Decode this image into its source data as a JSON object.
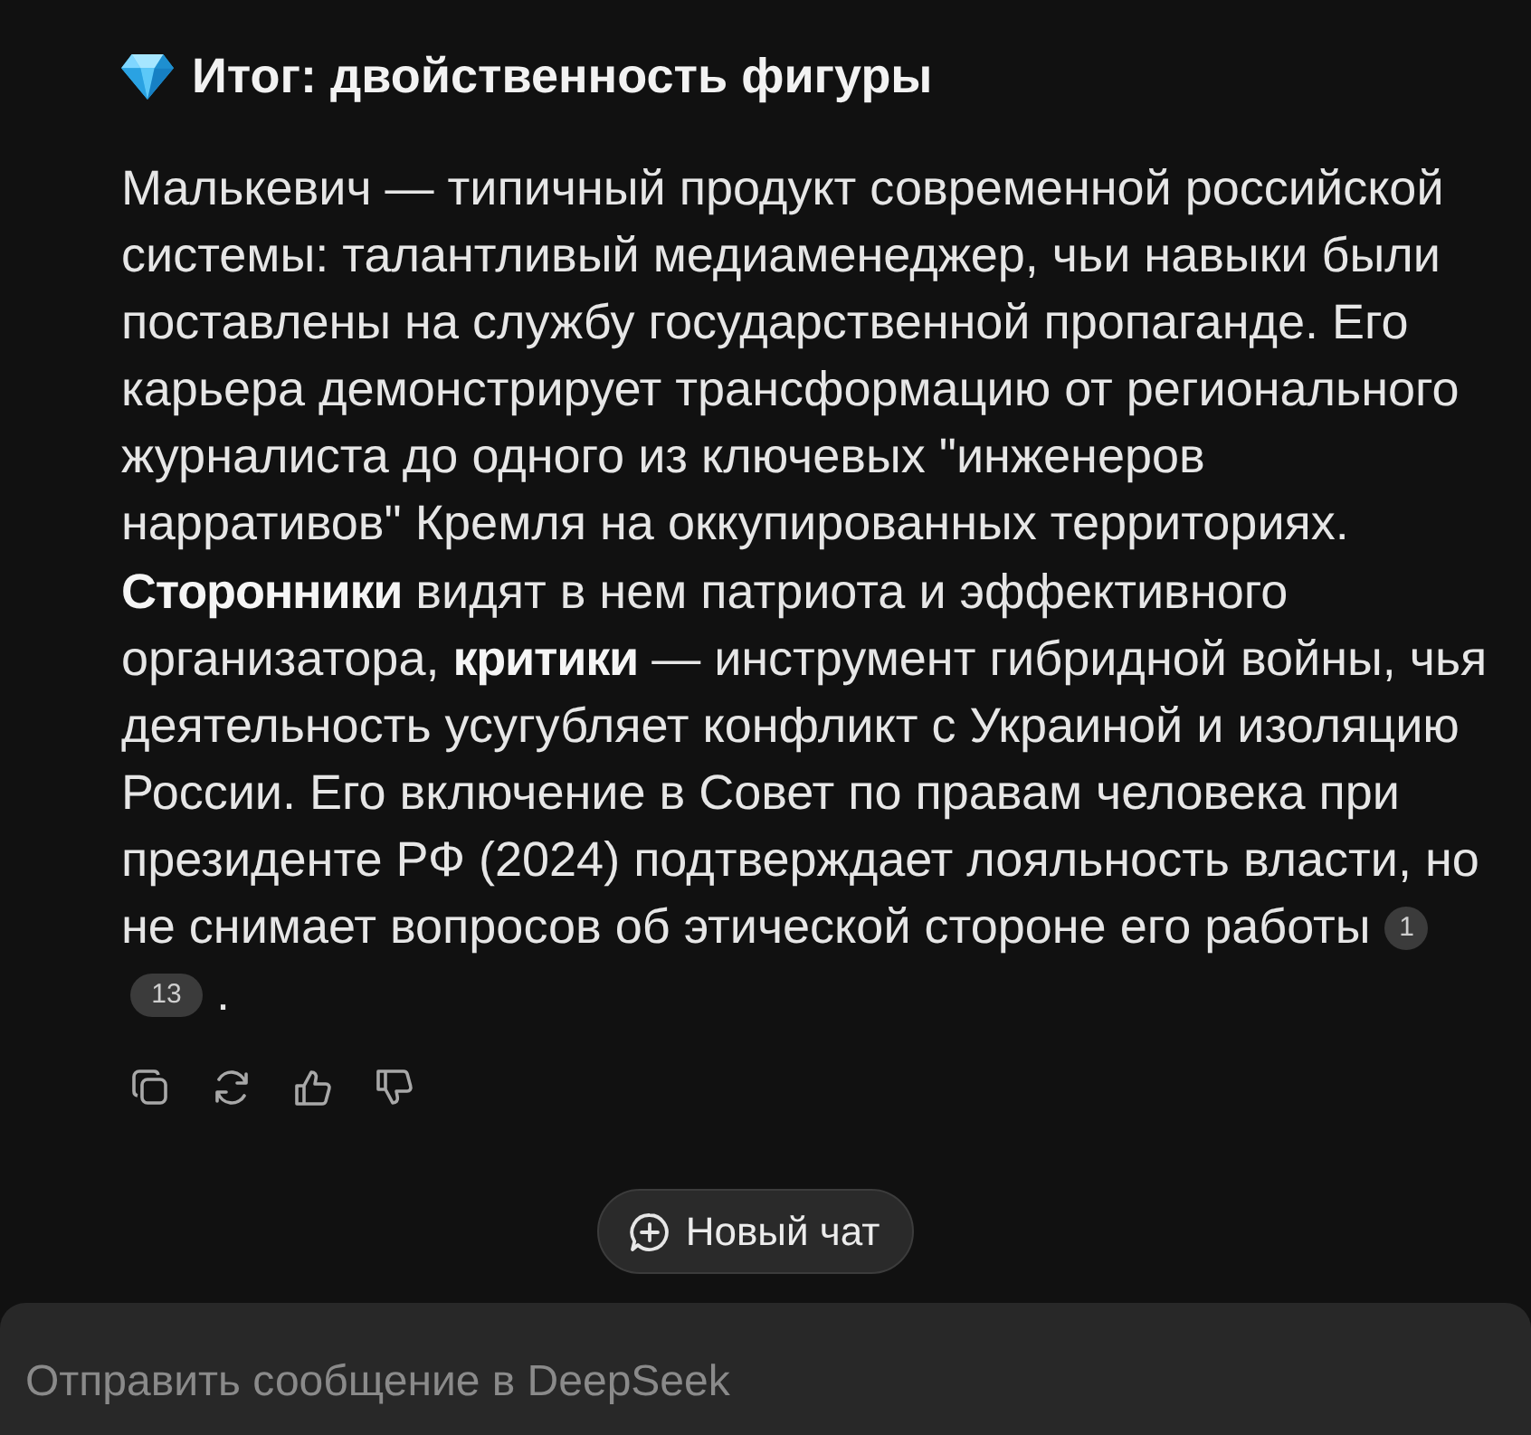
{
  "heading": {
    "title": "Итог: двойственность фигуры"
  },
  "answer": {
    "text": "Малькевич — типичный продукт современной российской системы: талантливый медиаменеджер, чьи навыки были поставлены на службу государственной пропаганде. Его карьера демонстрирует трансформацию от регионального журналиста до одного из ключевых \"инженеров нарративов\" Кремля на оккупированных территориях. **Сторонники** видят в нем патриота и эффективного организатора, **критики** — инструмент гибридной войны, чья деятельность усугубляет конфликт с Украиной и изоляцию России. Его включение в Совет по правам человека при президенте РФ (2024) подтверждает лояльность власти, но не снимает вопросов об этической стороне его работы",
    "citations": [
      "1",
      "13"
    ],
    "tail": "."
  },
  "actions": [
    {
      "kind": "copy"
    },
    {
      "kind": "regenerate"
    },
    {
      "kind": "like"
    },
    {
      "kind": "dislike"
    }
  ],
  "new_chat_button": {
    "label": "Новый чат"
  },
  "composer": {
    "placeholder": "Отправить сообщение в DeepSeek"
  }
}
